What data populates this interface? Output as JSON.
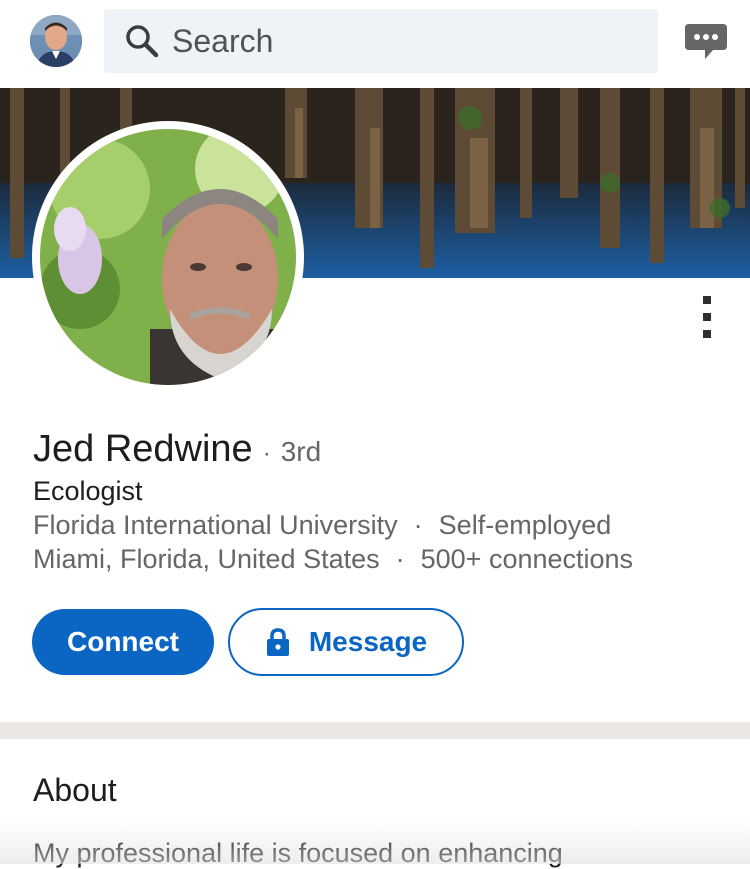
{
  "header": {
    "search_placeholder": "Search",
    "icons": {
      "search": "search-icon",
      "messaging": "messaging-icon"
    }
  },
  "profile": {
    "name": "Jed Redwine",
    "separator": "·",
    "degree": "3rd",
    "headline": "Ecologist",
    "education": "Florida International University",
    "company": "Self-employed",
    "location": "Miami, Florida, United States",
    "connections": "500+ connections",
    "dot": "·"
  },
  "actions": {
    "connect_label": "Connect",
    "message_label": "Message"
  },
  "about": {
    "title": "About",
    "text": "My professional life is focused on enhancing"
  },
  "colors": {
    "accent": "#0a66c2",
    "search_bg": "#eef3f8",
    "divider": "#ebe7e2"
  }
}
